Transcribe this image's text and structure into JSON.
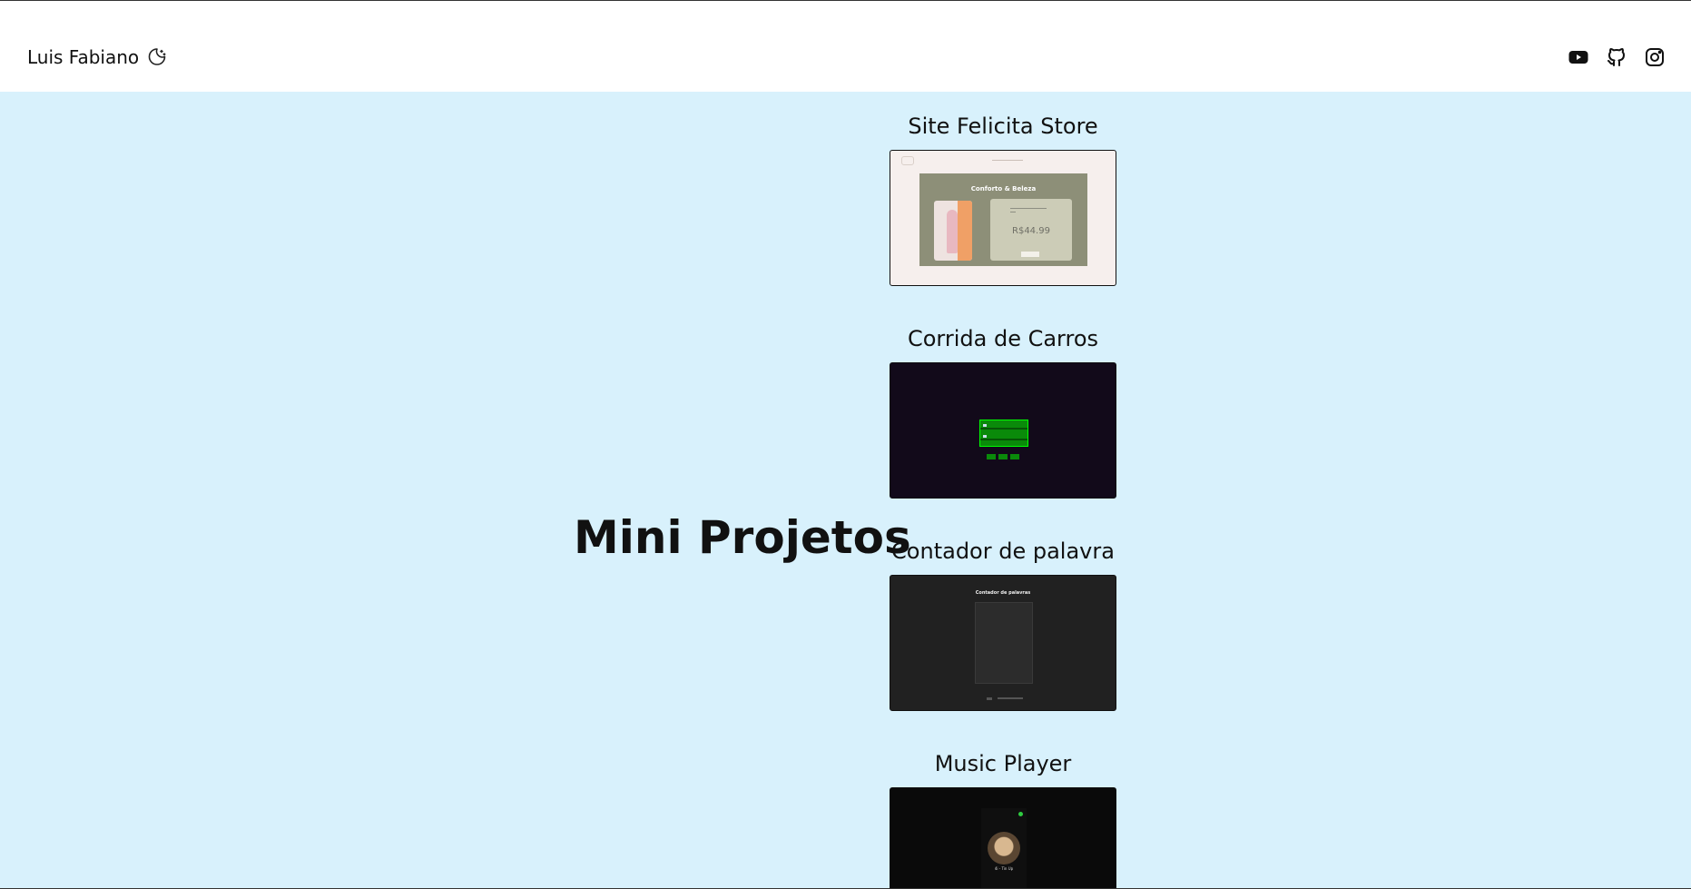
{
  "header": {
    "brand_name": "Luis Fabiano",
    "theme_toggle_icon": "moon-icon",
    "socials": [
      {
        "name": "youtube",
        "icon": "youtube-icon"
      },
      {
        "name": "github",
        "icon": "github-icon"
      },
      {
        "name": "instagram",
        "icon": "instagram-icon"
      }
    ]
  },
  "main": {
    "section_title": "Mini Projetos",
    "projects": [
      {
        "title": "Site Felicita Store",
        "preview": {
          "hero_title": "Conforto & Beleza",
          "price_currency": "R$",
          "price_value": "44.99"
        }
      },
      {
        "title": "Corrida de Carros"
      },
      {
        "title": "Contador de palavra",
        "preview": {
          "heading": "Contador de palavras"
        }
      },
      {
        "title": "Music Player",
        "preview": {
          "track": "4i - Tin Up"
        }
      }
    ]
  },
  "colors": {
    "main_background": "#d8f1fc",
    "header_background": "#ffffff",
    "text": "#111111"
  }
}
